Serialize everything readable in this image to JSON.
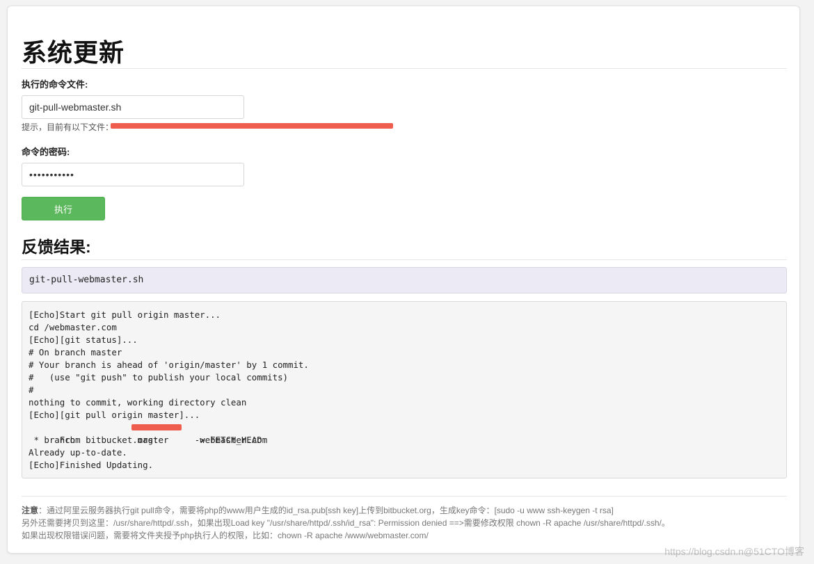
{
  "page": {
    "title": "系统更新"
  },
  "form": {
    "command_file_label": "执行的命令文件:",
    "command_file_value": "git-pull-webmaster.sh",
    "hint_text": "提示，目前有以下文件：",
    "password_label": "命令的密码:",
    "password_value": "•••••••••••",
    "execute_button_label": "执行"
  },
  "result": {
    "section_title": "反馈结果:",
    "command_name": "git-pull-webmaster.sh",
    "output_lines": [
      "[Echo]Start git pull origin master...",
      "cd /webmaster.com",
      "[Echo][git status]...",
      "# On branch master",
      "# Your branch is ahead of 'origin/master' by 1 commit.",
      "#   (use \"git push\" to publish your local commits)",
      "#",
      "nothing to commit, working directory clean",
      "[Echo][git pull origin master]...",
      "From bitbucket.org:        webmaster.com",
      " * branch            master     -> FETCH_HEAD",
      "Already up-to-date.",
      "[Echo]Finished Updating."
    ]
  },
  "notes": {
    "prefix": "注意",
    "line1": "：通过阿里云服务器执行git pull命令，需要将php的www用户生成的id_rsa.pub[ssh key]上传到bitbucket.org，生成key命令：[sudo -u www ssh-keygen -t rsa]",
    "line2": "另外还需要拷贝到这里：/usr/share/httpd/.ssh，如果出现Load key \"/usr/share/httpd/.ssh/id_rsa\": Permission denied ==>需要修改权限 chown -R apache /usr/share/httpd/.ssh/。",
    "line3": "如果出现权限错误问题，需要将文件夹授予php执行人的权限，比如：chown -R apache /www/webmaster.com/"
  },
  "watermark": "https://blog.csdn.n@51CTO博客",
  "colors": {
    "button_green": "#5cb85c",
    "redaction_red": "#ef5d4e",
    "command_box_bg": "#ecebf5",
    "output_box_bg": "#f5f5f5"
  }
}
